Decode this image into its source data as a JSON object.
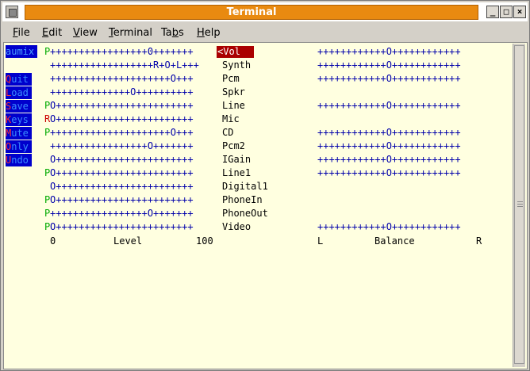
{
  "window": {
    "title": "Terminal",
    "controls": {
      "minimize": "_",
      "maximize": "□",
      "close": "×"
    }
  },
  "menubar": {
    "items": [
      {
        "label": "File",
        "underline": "F",
        "rest": "ile"
      },
      {
        "label": "Edit",
        "underline": "E",
        "rest": "dit"
      },
      {
        "label": "View",
        "underline": "V",
        "rest": "iew"
      },
      {
        "label": "Terminal",
        "underline": "T",
        "rest": "erminal"
      },
      {
        "label": "Tabs",
        "underline": "b",
        "pre": "Ta",
        "rest": "s"
      },
      {
        "label": "Help",
        "underline": "H",
        "rest": "elp"
      }
    ]
  },
  "aumix": {
    "title": "aumix",
    "side_buttons": [
      {
        "label": "Quit",
        "key": "Q",
        "rest": "uit"
      },
      {
        "label": "Load",
        "key": "L",
        "rest": "oad"
      },
      {
        "label": "Save",
        "key": "S",
        "rest": "ave"
      },
      {
        "label": "Keys",
        "key": "K",
        "rest": "eys"
      },
      {
        "label": "Mute",
        "key": "M",
        "rest": "ute"
      },
      {
        "label": "Only",
        "key": "O",
        "rest": "nly"
      },
      {
        "label": "Undo",
        "key": "U",
        "rest": "ndo"
      }
    ],
    "channels": [
      {
        "flag": "P",
        "flag_color": "#00aa00",
        "level": "+++++++++++++++++0+++++++",
        "name": "<Vol",
        "balance": "++++++++++++O++++++++++++",
        "selected": true
      },
      {
        "flag": "",
        "flag_color": "#000000",
        "level": "++++++++++++++++++R+O+L+++",
        "name": "Synth",
        "balance": "++++++++++++O++++++++++++"
      },
      {
        "flag": "",
        "flag_color": "#000000",
        "level": "+++++++++++++++++++++O+++",
        "name": "Pcm",
        "balance": "++++++++++++O++++++++++++"
      },
      {
        "flag": "",
        "flag_color": "#000000",
        "level": "++++++++++++++O++++++++++",
        "name": "Spkr",
        "balance": ""
      },
      {
        "flag": "P",
        "flag_color": "#00aa00",
        "level": "O++++++++++++++++++++++++",
        "name": "Line",
        "balance": "++++++++++++O++++++++++++"
      },
      {
        "flag": "R",
        "flag_color": "#cc0000",
        "level": "O++++++++++++++++++++++++",
        "name": "Mic",
        "balance": ""
      },
      {
        "flag": "P",
        "flag_color": "#00aa00",
        "level": "+++++++++++++++++++++O+++",
        "name": "CD",
        "balance": "++++++++++++O++++++++++++"
      },
      {
        "flag": "",
        "flag_color": "#000000",
        "level": "+++++++++++++++++O+++++++",
        "name": "Pcm2",
        "balance": "++++++++++++O++++++++++++"
      },
      {
        "flag": "",
        "flag_color": "#000000",
        "level": "O++++++++++++++++++++++++",
        "name": "IGain",
        "balance": "++++++++++++O++++++++++++"
      },
      {
        "flag": "P",
        "flag_color": "#00aa00",
        "level": "O++++++++++++++++++++++++",
        "name": "Line1",
        "balance": "++++++++++++O++++++++++++"
      },
      {
        "flag": "",
        "flag_color": "#000000",
        "level": "O++++++++++++++++++++++++",
        "name": "Digital1",
        "balance": ""
      },
      {
        "flag": "P",
        "flag_color": "#00aa00",
        "level": "O++++++++++++++++++++++++",
        "name": "PhoneIn",
        "balance": ""
      },
      {
        "flag": "P",
        "flag_color": "#00aa00",
        "level": "+++++++++++++++++O+++++++",
        "name": "PhoneOut",
        "balance": ""
      },
      {
        "flag": "P",
        "flag_color": "#00aa00",
        "level": "O++++++++++++++++++++++++",
        "name": "Video",
        "balance": "++++++++++++O++++++++++++"
      }
    ],
    "footer": {
      "level_min": "0",
      "level_label": "Level",
      "level_max": "100",
      "balance_left": "L",
      "balance_label": "Balance",
      "balance_right": "R"
    }
  },
  "colors": {
    "titlebar": "#e98a10",
    "terminal_bg": "#ffffe0",
    "button_bg": "#0000cc",
    "level_text": "#0000aa",
    "highlight": "#aa0000"
  }
}
